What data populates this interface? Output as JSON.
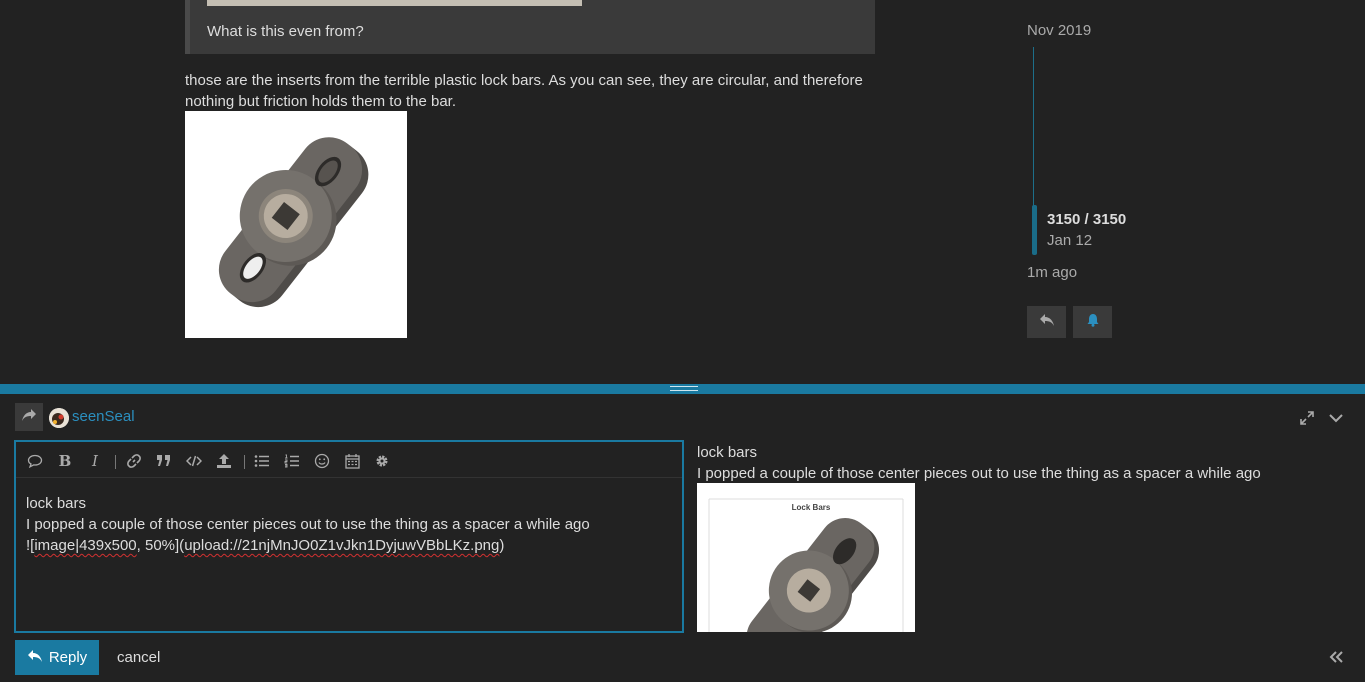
{
  "topic": {
    "quote_text": "What is this even from?",
    "post_text": "those are the inserts from the terrible plastic lock bars. As you can see, they are circular, and therefore nothing but friction holds them to the bar.",
    "post_image_icon": "lock-bar-photo"
  },
  "timeline": {
    "start_date": "Nov 2019",
    "position": "3150 / 3150",
    "current_date": "Jan 12",
    "last_activity": "1m ago",
    "reply_icon": "reply-icon",
    "notification_icon": "bell-icon"
  },
  "composer": {
    "username": "seenSeal",
    "reply_to_icon": "share-arrow-icon",
    "toolbar": [
      "speech-bubble-icon",
      "bold-icon",
      "italic-icon",
      "link-icon",
      "quote-icon",
      "code-icon",
      "upload-icon",
      "bullet-list-icon",
      "numbered-list-icon",
      "emoji-icon",
      "calendar-icon",
      "gear-icon"
    ],
    "editor_line1": "lock bars",
    "editor_line2": "I popped a couple of those center pieces out to use the thing as a spacer a while ago",
    "editor_line3_a": "![",
    "editor_line3_b": "image|439x500",
    "editor_line3_c": ", 50%](",
    "editor_line3_d": "upload://21njMnJO0Z1vJkn1DyjuwVBbLKz.png",
    "editor_line3_e": ")",
    "preview_line1": "lock bars",
    "preview_line2": "I popped a couple of those center pieces out to use the thing as a spacer a while ago",
    "preview_image_caption": "Lock Bars",
    "reply_label": "Reply",
    "cancel_label": "cancel"
  },
  "colors": {
    "accent": "#1a7aa1",
    "background": "#222222",
    "link": "#2b8fbf"
  }
}
